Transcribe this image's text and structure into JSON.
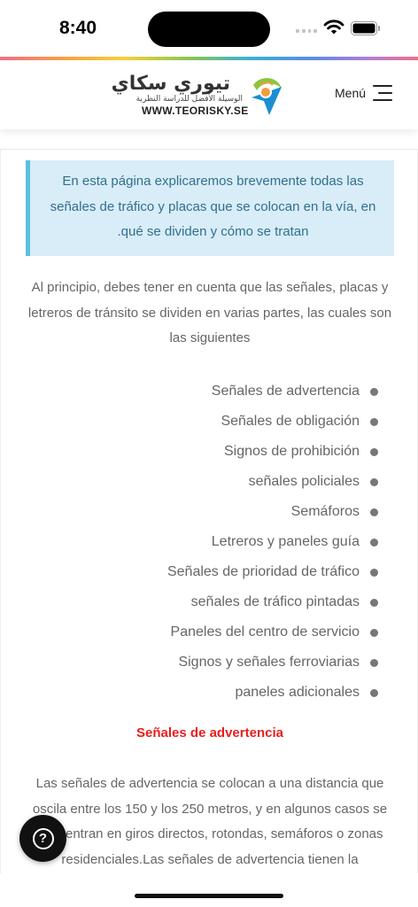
{
  "status_bar": {
    "time": "8:40"
  },
  "header": {
    "logo": {
      "arabic_title": "تيوري سكاي",
      "arabic_subtitle": "الوسيلة الأفضل للدراسة النظرية",
      "url_text": "WWW.TEORISKY.SE",
      "mark_colors": [
        "#8bc540",
        "#1a8fd1"
      ]
    },
    "menu_label": "Menú"
  },
  "content": {
    "intro": "En esta página explicaremos brevemente todas las señales de tráfico y placas que se colocan en la vía, en .qué se dividen y cómo se tratan",
    "paragraph_1": "Al principio, debes tener en cuenta que las señales, placas y letreros de tránsito se dividen en varias partes, las cuales son las siguientes",
    "list_items": [
      "Señales de advertencia",
      "Señales de obligación",
      "Signos de prohibición",
      "señales policiales",
      "Semáforos",
      "Letreros y paneles guía",
      "Señales de prioridad de tráfico",
      "señales de tráfico pintadas",
      "Paneles del centro de servicio",
      "Signos y señales ferroviarias",
      "paneles adicionales"
    ],
    "section_title": "Señales de advertencia",
    "paragraph_2": "Las señales de advertencia se colocan a una distancia que oscila entre los 150 y los 250 metros, y en algunos casos se encuentran en giros directos, rotondas, semáforos o zonas residenciales.Las señales de advertencia tienen la"
  },
  "help_button": {
    "icon": "question-circle-icon",
    "glyph": "?"
  },
  "colors": {
    "accent_red": "#e81e1e",
    "intro_bg": "#d8edf7",
    "intro_border": "#5bc0de",
    "intro_text": "#31708f"
  }
}
